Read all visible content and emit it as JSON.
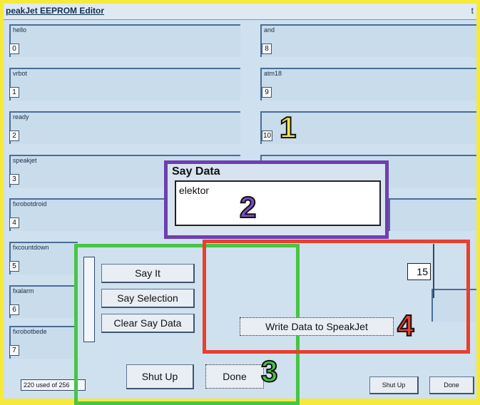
{
  "window": {
    "title": "peakJet EEPROM Editor",
    "control": "t"
  },
  "slots_left": [
    {
      "label": "hello",
      "num": "0"
    },
    {
      "label": "vrbot",
      "num": "1"
    },
    {
      "label": "ready",
      "num": "2"
    },
    {
      "label": "speakjet",
      "num": "3"
    },
    {
      "label": "fxrobotdroid",
      "num": "4"
    },
    {
      "label": "fxcountdown",
      "num": "5"
    },
    {
      "label": "fxalarm",
      "num": "6"
    },
    {
      "label": "fxrobotbede",
      "num": "7"
    }
  ],
  "slots_right": [
    {
      "label": "and",
      "num": "8"
    },
    {
      "label": "atm18",
      "num": "9"
    },
    {
      "label": "",
      "num": "10"
    }
  ],
  "say_data": {
    "title": "Say Data",
    "value": "elektor"
  },
  "buttons": {
    "say_it": "Say It",
    "say_selection": "Say Selection",
    "clear_say_data": "Clear Say Data",
    "shut_up": "Shut Up",
    "done": "Done",
    "write_data": "Write Data to SpeakJet",
    "shut_up_small": "Shut Up",
    "done_small": "Done"
  },
  "field_15": "15",
  "status": "220 used of 256",
  "callouts": {
    "one": "1",
    "two": "2",
    "three": "3",
    "four": "4"
  },
  "colors": {
    "purple": "#6e3fb1",
    "green": "#48c446",
    "red": "#e83f2f",
    "yellow": "#f5ea3a"
  }
}
